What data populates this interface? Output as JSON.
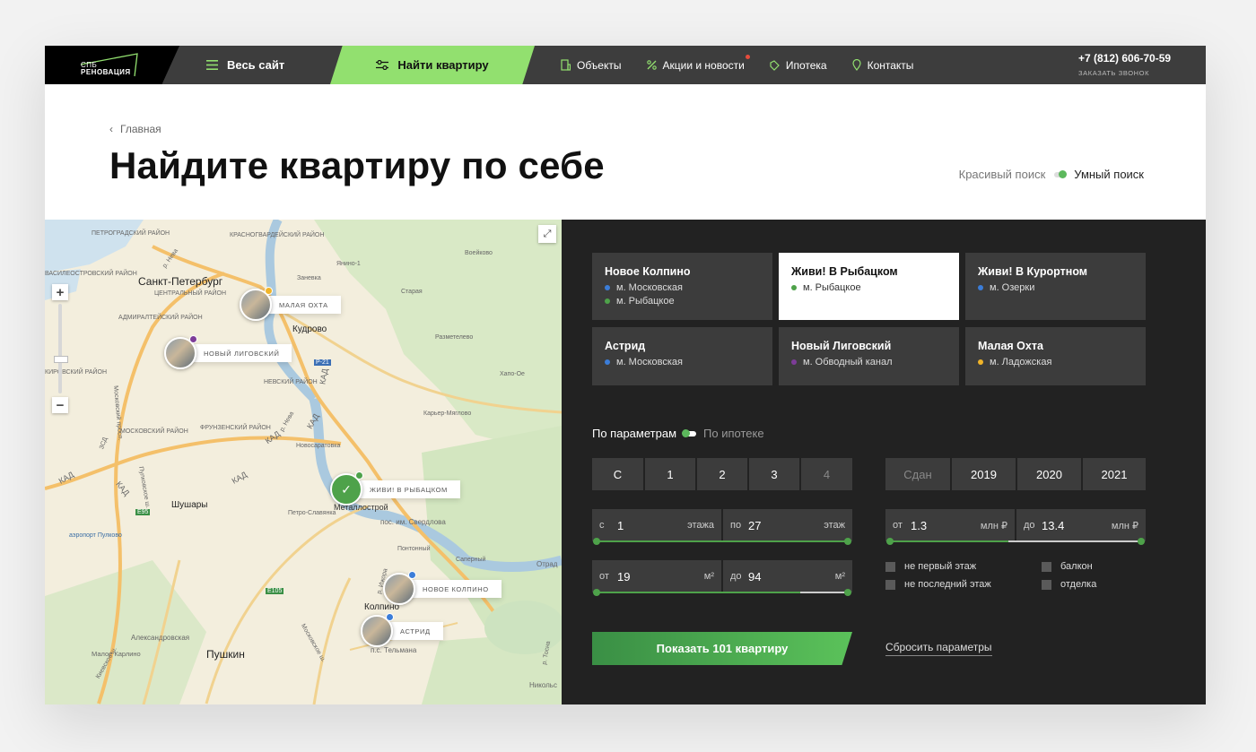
{
  "logo": {
    "line1": "СПБ",
    "line2": "РЕНОВАЦИЯ"
  },
  "nav": {
    "all_site": "Весь сайт",
    "find": "Найти квартиру",
    "links": [
      {
        "label": "Объекты",
        "icon": "building-icon"
      },
      {
        "label": "Акции и новости",
        "icon": "percent-icon",
        "badge": true
      },
      {
        "label": "Ипотека",
        "icon": "tag-icon"
      },
      {
        "label": "Контакты",
        "icon": "location-pin-icon"
      }
    ],
    "phone": "+7 (812) 606-70-59",
    "callback": "ЗАКАЗАТЬ ЗВОНОК"
  },
  "breadcrumb": "Главная",
  "title": "Найдите квартиру по себе",
  "search_mode": {
    "a": "Красивый поиск",
    "b": "Умный поиск"
  },
  "map": {
    "labels": {
      "spb": "Санкт-Петербург",
      "shushary": "Шушары",
      "pushkin": "Пушкин",
      "kolpino": "Колпино",
      "yanino": "Янино-1",
      "zanevka": "Заневка",
      "kudrovo": "Кудрово",
      "staraya": "Старая",
      "voeykovo": "Воейково",
      "razmetelevo": "Разметелево",
      "khapo": "Хапо-Ое",
      "karer": "Карьер-Мяглово",
      "novosaratovka": "Новосаратовка",
      "metallostroy": "Металлострой",
      "petro": "Петро-Славянка",
      "sverdlova": "пос. им. Свердлова",
      "pontonny": "Понтонный",
      "saperny": "Саперный",
      "otradnoe": "Отрад",
      "nikolskoe": "Никольс",
      "telmana": "п.с. Тельмана",
      "aleksandrovskaya": "Александровская",
      "malo_karlino": "Малое Карлино",
      "airport": "аэропорт Пулково",
      "kad": "КАД",
      "r21": "Р-21",
      "e95": "Е95",
      "e105": "Е105",
      "petrograd": "ПЕТРОГРАДСКИЙ РАЙОН",
      "krasnogvard": "КРАСНОГВАРДЕЙСКИЙ РАЙОН",
      "vasileostr": "ВАСИЛЕОСТРОВСКИЙ РАЙОН",
      "central": "ЦЕНТРАЛЬНЫЙ РАЙОН",
      "admiral": "АДМИРАЛТЕЙСКИЙ РАЙОН",
      "nevsky": "НЕВСКИЙ РАЙОН",
      "kirovsky": "КИРОВСКИЙ РАЙОН",
      "moskovsky": "МОСКОВСКИЙ РАЙОН",
      "frunze": "ФРУНЗЕНСКИЙ РАЙОН",
      "neva": "р. Нева",
      "moskovsky_pr": "Московский просп.",
      "pulkovskoe": "Пулковское ш.",
      "moskovskoe": "Московское ш.",
      "kievskoe": "Киевское ш.",
      "zsd": "ЗСД",
      "izhora": "р. Ижора",
      "tosna": "р. Тосна"
    },
    "pins": [
      {
        "label": "МАЛАЯ ОХТА",
        "dot": "#f0b429"
      },
      {
        "label": "НОВЫЙ ЛИГОВСКИЙ",
        "dot": "#7d3c98"
      },
      {
        "label": "ЖИВИ! В РЫБАЦКОМ",
        "dot": "#4ea24a",
        "selected": true
      },
      {
        "label": "НОВОЕ КОЛПИНО",
        "dot": "#3b7dd8"
      },
      {
        "label": "АСТРИД",
        "dot": "#3b7dd8"
      }
    ]
  },
  "projects": [
    {
      "name": "Новое Колпино",
      "metros": [
        {
          "name": "м. Московская",
          "color": "#3b7dd8"
        },
        {
          "name": "м. Рыбацкое",
          "color": "#4ea24a"
        }
      ]
    },
    {
      "name": "Живи! В Рыбацком",
      "metros": [
        {
          "name": "м. Рыбацкое",
          "color": "#4ea24a"
        }
      ],
      "active": true
    },
    {
      "name": "Живи! В Курортном",
      "metros": [
        {
          "name": "м. Озерки",
          "color": "#3b7dd8"
        }
      ]
    },
    {
      "name": "Астрид",
      "metros": [
        {
          "name": "м. Московская",
          "color": "#3b7dd8"
        }
      ]
    },
    {
      "name": "Новый Лиговский",
      "metros": [
        {
          "name": "м. Обводный канал",
          "color": "#7d3c98"
        }
      ]
    },
    {
      "name": "Малая Охта",
      "metros": [
        {
          "name": "м. Ладожская",
          "color": "#f0b429"
        }
      ]
    }
  ],
  "filter_mode": {
    "a": "По параметрам",
    "b": "По ипотеке"
  },
  "rooms": [
    "С",
    "1",
    "2",
    "3",
    "4"
  ],
  "years": [
    "Сдан",
    "2019",
    "2020",
    "2021"
  ],
  "floor": {
    "from_pre": "с",
    "from": "1",
    "from_unit": "этажа",
    "to_pre": "по",
    "to": "27",
    "to_unit": "этаж",
    "fill_from": 0,
    "fill_to": 1
  },
  "price": {
    "from_pre": "от",
    "from": "1.3",
    "from_unit": "млн ₽",
    "to_pre": "до",
    "to": "13.4",
    "to_unit": "млн ₽",
    "fill_from": 0,
    "fill_to": 0.47
  },
  "area": {
    "from_pre": "от",
    "from": "19",
    "from_unit": "м²",
    "to_pre": "до",
    "to": "94",
    "to_unit": "м²",
    "fill_from": 0,
    "fill_to": 0.81
  },
  "checkboxes": {
    "not_first": "не первый этаж",
    "not_last": "не последний этаж",
    "balcony": "балкон",
    "finish": "отделка"
  },
  "show_button": "Показать 101 квартиру",
  "reset": "Сбросить параметры"
}
